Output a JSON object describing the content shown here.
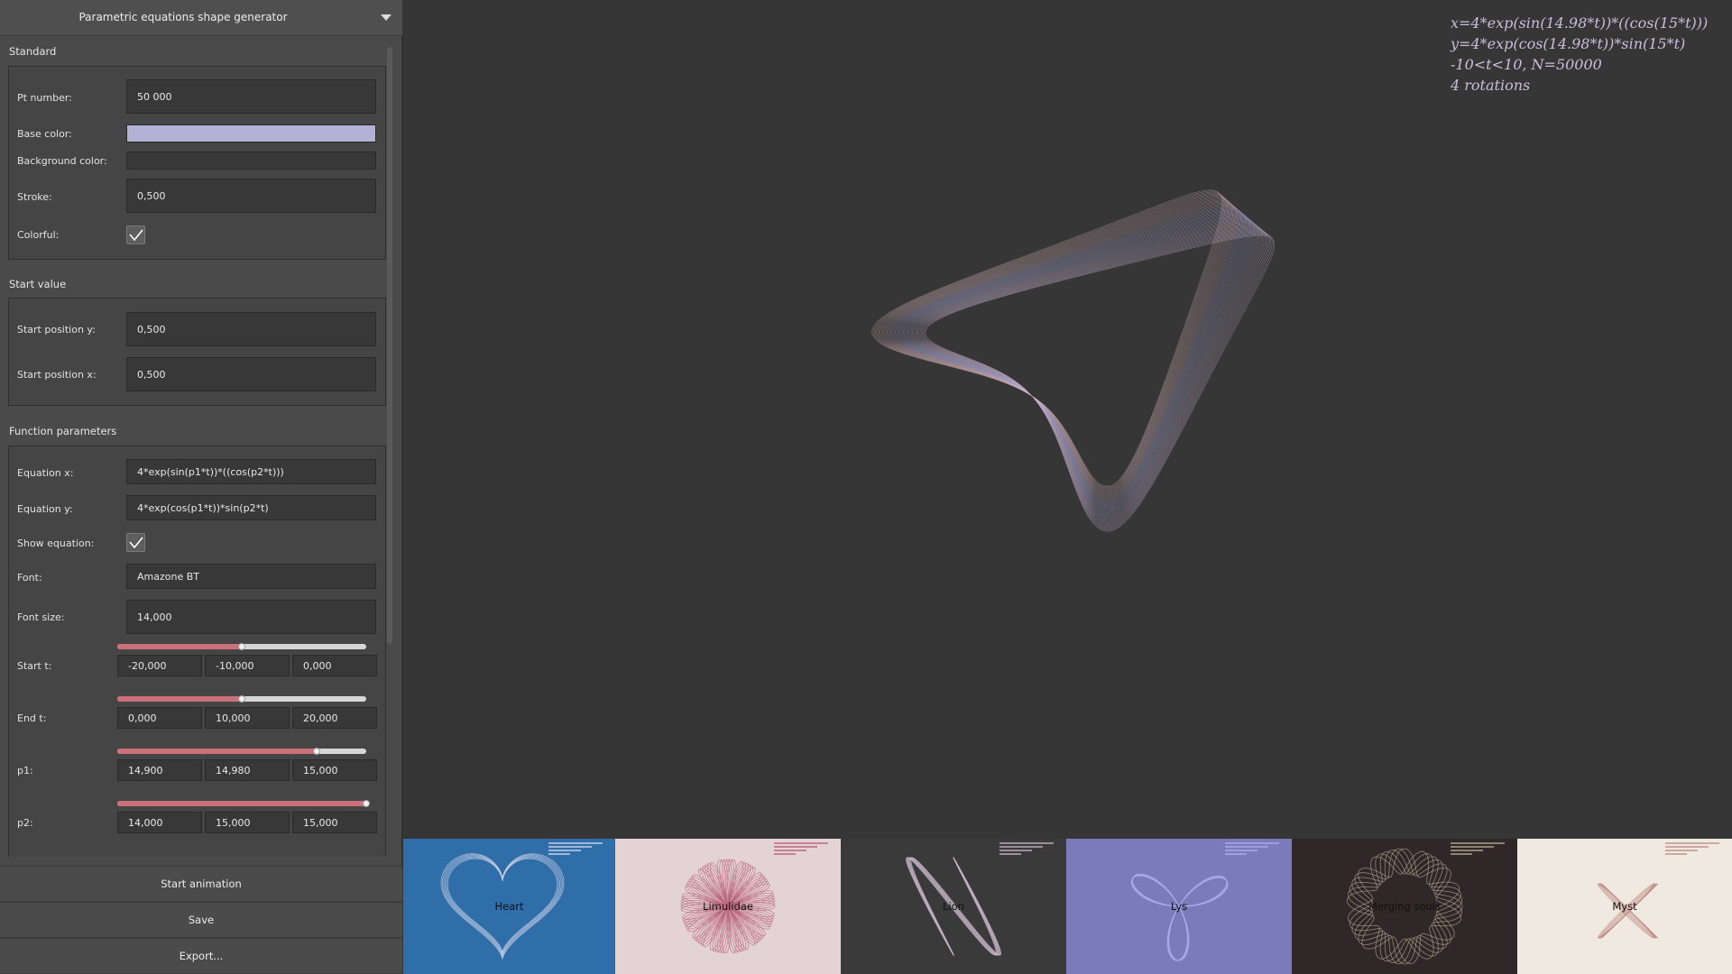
{
  "panel": {
    "title": "Parametric equations shape generator"
  },
  "standard": {
    "section_label": "Standard",
    "pt_number_label": "Pt number:",
    "pt_number_value": "50 000",
    "base_color_label": "Base color:",
    "base_color": "#b3b0d6",
    "background_color_label": "Background color:",
    "background_color": "#383838",
    "stroke_label": "Stroke:",
    "stroke_value": "0,500",
    "colorful_label": "Colorful:",
    "colorful_checked": true
  },
  "start_value": {
    "section_label": "Start value",
    "start_y_label": "Start position y:",
    "start_y_value": "0,500",
    "start_x_label": "Start position x:",
    "start_x_value": "0,500"
  },
  "function_parameters": {
    "section_label": "Function parameters",
    "eq_x_label": "Equation x:",
    "eq_x_value": "4*exp(sin(p1*t))*((cos(p2*t)))",
    "eq_y_label": "Equation y:",
    "eq_y_value": "4*exp(cos(p1*t))*sin(p2*t)",
    "show_eq_label": "Show equation:",
    "show_eq_checked": true,
    "font_label": "Font:",
    "font_value": "Amazone BT",
    "font_size_label": "Font size:",
    "font_size_value": "14,000",
    "start_t": {
      "label": "Start t:",
      "min": "-20,000",
      "value": "-10,000",
      "max": "0,000",
      "fraction": 0.5
    },
    "end_t": {
      "label": "End t:",
      "min": "0,000",
      "value": "10,000",
      "max": "20,000",
      "fraction": 0.5
    },
    "p1": {
      "label": "p1:",
      "min": "14,900",
      "value": "14,980",
      "max": "15,000",
      "fraction": 0.8
    },
    "p2": {
      "label": "p2:",
      "min": "14,000",
      "value": "15,000",
      "max": "15,000",
      "fraction": 1.0
    }
  },
  "buttons": {
    "start_animation": "Start animation",
    "save": "Save",
    "export": "Export..."
  },
  "canvas": {
    "equation_lines": [
      "x=4*exp(sin(14.98*t))*((cos(15*t)))",
      "y=4*exp(cos(14.98*t))*sin(15*t)",
      "-10<t<10, N=50000",
      "4 rotations"
    ],
    "colors": {
      "stroke_a": "#c7b3cf",
      "stroke_b": "#b4b0e0",
      "stroke_c": "#d6b3ba"
    }
  },
  "presets": [
    {
      "label": "Heart",
      "bg": "#2f6ea8",
      "stroke": "#d0d4ea",
      "shape": "heart"
    },
    {
      "label": "Limulidae",
      "bg": "#e3d3d4",
      "stroke": "#b9607a",
      "shape": "flower"
    },
    {
      "label": "Lion",
      "bg": "#3a3a3a",
      "stroke": "#c4b3c4",
      "shape": "knot"
    },
    {
      "label": "Lys",
      "bg": "#7a7bb8",
      "stroke": "#a9b0ea",
      "shape": "lys"
    },
    {
      "label": "Merging souls",
      "bg": "#302828",
      "stroke": "#b8aa96",
      "shape": "soul"
    },
    {
      "label": "Myst",
      "bg": "#efe9df",
      "stroke": "#c08a86",
      "shape": "myst"
    }
  ]
}
